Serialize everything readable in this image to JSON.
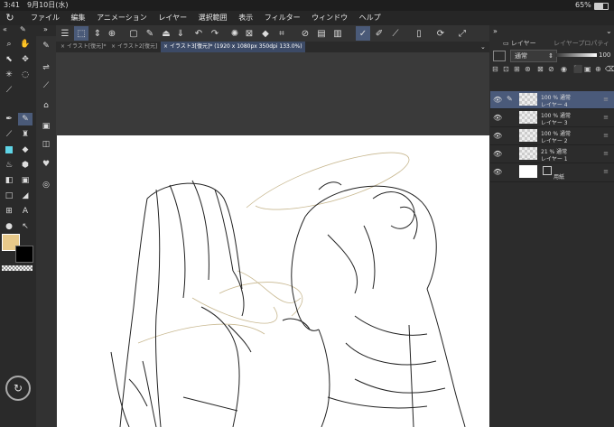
{
  "status": {
    "time": "3:41",
    "date": "9月10日(水)",
    "battery": "65%"
  },
  "menu": [
    "ファイル",
    "編集",
    "アニメーション",
    "レイヤー",
    "選択範囲",
    "表示",
    "フィルター",
    "ウィンドウ",
    "ヘルプ"
  ],
  "tabs": [
    {
      "label": "イラスト[復元]*"
    },
    {
      "label": "イラスト2[復元]"
    },
    {
      "label": "イラスト3[復元]* (1920 x 1080px 350dpi 133.0%)"
    }
  ],
  "layer_panel": {
    "tab_layer": "レイヤー",
    "tab_properties": "レイヤープロパティ",
    "blend_mode": "通常",
    "opacity": "100",
    "layers": [
      {
        "name": "レイヤー 4",
        "info": "100 %  通常",
        "selected": true
      },
      {
        "name": "レイヤー 3",
        "info": "100 %  通常",
        "selected": false
      },
      {
        "name": "レイヤー 2",
        "info": "100 %  通常",
        "selected": false
      },
      {
        "name": "レイヤー 1",
        "info": "21 %  通常",
        "selected": false
      },
      {
        "name": "用紙",
        "info": "",
        "selected": false
      }
    ]
  },
  "colors": {
    "main": "#e8c98a",
    "sub": "#000000",
    "accent": "#4a5a78"
  }
}
